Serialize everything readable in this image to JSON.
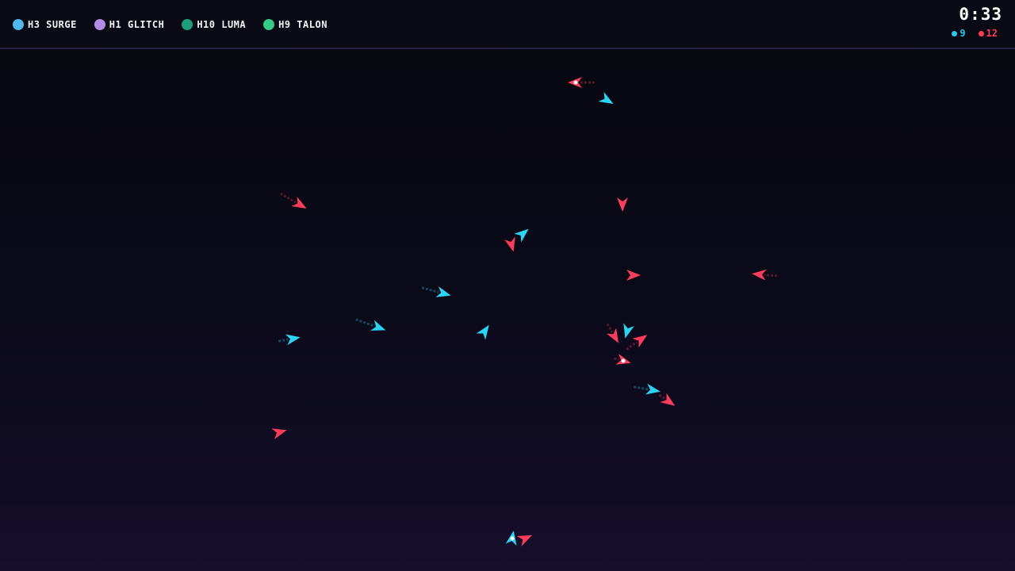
{
  "hud": {
    "players": [
      {
        "label": "H3 SURGE",
        "color": "#4fb8ec"
      },
      {
        "label": "H1 GLITCH",
        "color": "#b48ae8"
      },
      {
        "label": "H10 LUMA",
        "color": "#1e9e78"
      },
      {
        "label": "H9 TALON",
        "color": "#33cc88"
      }
    ],
    "timer": "0:33",
    "scores": {
      "cyan": {
        "text": "9",
        "color": "#2cc8ea"
      },
      "red": {
        "text": "12",
        "color": "#ff3a5c"
      }
    }
  },
  "arena": {
    "colors": {
      "cyan": "#2cd3f2",
      "red": "#ff3c5c"
    }
  }
}
